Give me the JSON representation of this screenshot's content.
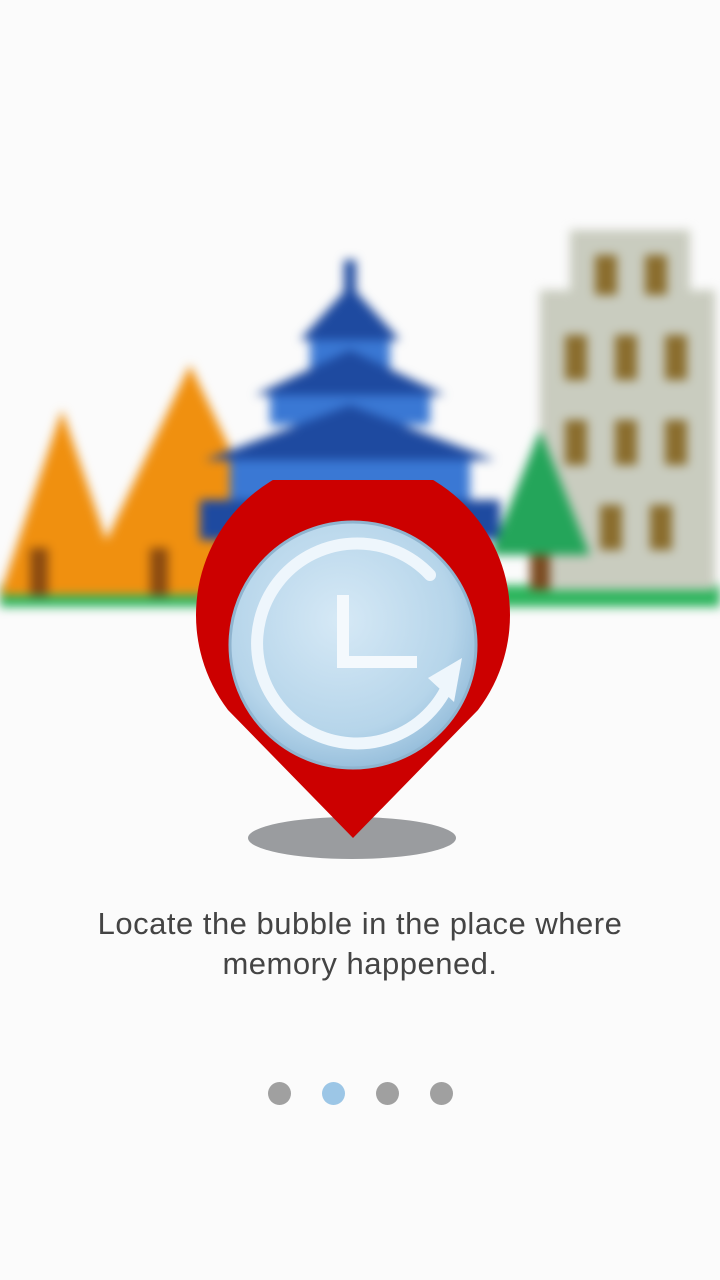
{
  "onboarding": {
    "caption_line1": "Locate the bubble in the place where",
    "caption_line2": "memory happened.",
    "illustration_icon": "clock-location-pin-icon",
    "pages": [
      {
        "name": "page-1",
        "active": false
      },
      {
        "name": "page-2",
        "active": true
      },
      {
        "name": "page-3",
        "active": false
      },
      {
        "name": "page-4",
        "active": false
      }
    ]
  },
  "colors": {
    "background": "#fbfbfb",
    "pin_red": "#cc0000",
    "pin_inner": "#bcd9ec",
    "dot_inactive": "#a0a0a0",
    "dot_active": "#9cc6e6",
    "text": "#444444"
  }
}
